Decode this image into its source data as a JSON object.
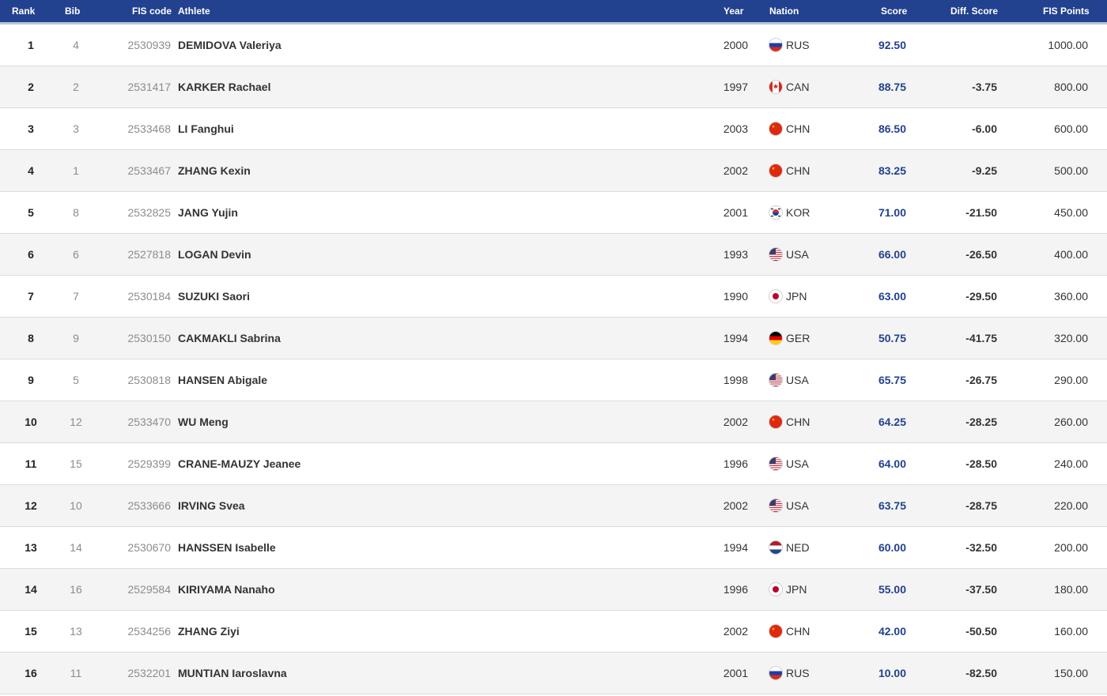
{
  "header": {
    "rank": "Rank",
    "bib": "Bib",
    "fis_code": "FIS code",
    "athlete": "Athlete",
    "year": "Year",
    "nation": "Nation",
    "score": "Score",
    "diff_score": "Diff. Score",
    "fis_points": "FIS Points"
  },
  "colors": {
    "header_bg": "#22418f",
    "score_text": "#22418f",
    "row_alt_bg": "#f4f4f4"
  },
  "rows": [
    {
      "rank": "1",
      "bib": "4",
      "fis_code": "2530939",
      "athlete": "DEMIDOVA Valeriya",
      "year": "2000",
      "nation": "RUS",
      "flag_icon": "flag-rus-icon",
      "score": "92.50",
      "diff": "",
      "points": "1000.00"
    },
    {
      "rank": "2",
      "bib": "2",
      "fis_code": "2531417",
      "athlete": "KARKER Rachael",
      "year": "1997",
      "nation": "CAN",
      "flag_icon": "flag-can-icon",
      "score": "88.75",
      "diff": "-3.75",
      "points": "800.00"
    },
    {
      "rank": "3",
      "bib": "3",
      "fis_code": "2533468",
      "athlete": "LI Fanghui",
      "year": "2003",
      "nation": "CHN",
      "flag_icon": "flag-chn-icon",
      "score": "86.50",
      "diff": "-6.00",
      "points": "600.00"
    },
    {
      "rank": "4",
      "bib": "1",
      "fis_code": "2533467",
      "athlete": "ZHANG Kexin",
      "year": "2002",
      "nation": "CHN",
      "flag_icon": "flag-chn-icon",
      "score": "83.25",
      "diff": "-9.25",
      "points": "500.00"
    },
    {
      "rank": "5",
      "bib": "8",
      "fis_code": "2532825",
      "athlete": "JANG Yujin",
      "year": "2001",
      "nation": "KOR",
      "flag_icon": "flag-kor-icon",
      "score": "71.00",
      "diff": "-21.50",
      "points": "450.00"
    },
    {
      "rank": "6",
      "bib": "6",
      "fis_code": "2527818",
      "athlete": "LOGAN Devin",
      "year": "1993",
      "nation": "USA",
      "flag_icon": "flag-usa-icon",
      "score": "66.00",
      "diff": "-26.50",
      "points": "400.00"
    },
    {
      "rank": "7",
      "bib": "7",
      "fis_code": "2530184",
      "athlete": "SUZUKI Saori",
      "year": "1990",
      "nation": "JPN",
      "flag_icon": "flag-jpn-icon",
      "score": "63.00",
      "diff": "-29.50",
      "points": "360.00"
    },
    {
      "rank": "8",
      "bib": "9",
      "fis_code": "2530150",
      "athlete": "CAKMAKLI Sabrina",
      "year": "1994",
      "nation": "GER",
      "flag_icon": "flag-ger-icon",
      "score": "50.75",
      "diff": "-41.75",
      "points": "320.00"
    },
    {
      "rank": "9",
      "bib": "5",
      "fis_code": "2530818",
      "athlete": "HANSEN Abigale",
      "year": "1998",
      "nation": "USA",
      "flag_icon": "flag-usa-icon",
      "score": "65.75",
      "diff": "-26.75",
      "points": "290.00"
    },
    {
      "rank": "10",
      "bib": "12",
      "fis_code": "2533470",
      "athlete": "WU Meng",
      "year": "2002",
      "nation": "CHN",
      "flag_icon": "flag-chn-icon",
      "score": "64.25",
      "diff": "-28.25",
      "points": "260.00"
    },
    {
      "rank": "11",
      "bib": "15",
      "fis_code": "2529399",
      "athlete": "CRANE-MAUZY Jeanee",
      "year": "1996",
      "nation": "USA",
      "flag_icon": "flag-usa-icon",
      "score": "64.00",
      "diff": "-28.50",
      "points": "240.00"
    },
    {
      "rank": "12",
      "bib": "10",
      "fis_code": "2533666",
      "athlete": "IRVING Svea",
      "year": "2002",
      "nation": "USA",
      "flag_icon": "flag-usa-icon",
      "score": "63.75",
      "diff": "-28.75",
      "points": "220.00"
    },
    {
      "rank": "13",
      "bib": "14",
      "fis_code": "2530670",
      "athlete": "HANSSEN Isabelle",
      "year": "1994",
      "nation": "NED",
      "flag_icon": "flag-ned-icon",
      "score": "60.00",
      "diff": "-32.50",
      "points": "200.00"
    },
    {
      "rank": "14",
      "bib": "16",
      "fis_code": "2529584",
      "athlete": "KIRIYAMA Nanaho",
      "year": "1996",
      "nation": "JPN",
      "flag_icon": "flag-jpn-icon",
      "score": "55.00",
      "diff": "-37.50",
      "points": "180.00"
    },
    {
      "rank": "15",
      "bib": "13",
      "fis_code": "2534256",
      "athlete": "ZHANG Ziyi",
      "year": "2002",
      "nation": "CHN",
      "flag_icon": "flag-chn-icon",
      "score": "42.00",
      "diff": "-50.50",
      "points": "160.00"
    },
    {
      "rank": "16",
      "bib": "11",
      "fis_code": "2532201",
      "athlete": "MUNTIAN Iaroslavna",
      "year": "2001",
      "nation": "RUS",
      "flag_icon": "flag-rus-icon",
      "score": "10.00",
      "diff": "-82.50",
      "points": "150.00"
    }
  ]
}
